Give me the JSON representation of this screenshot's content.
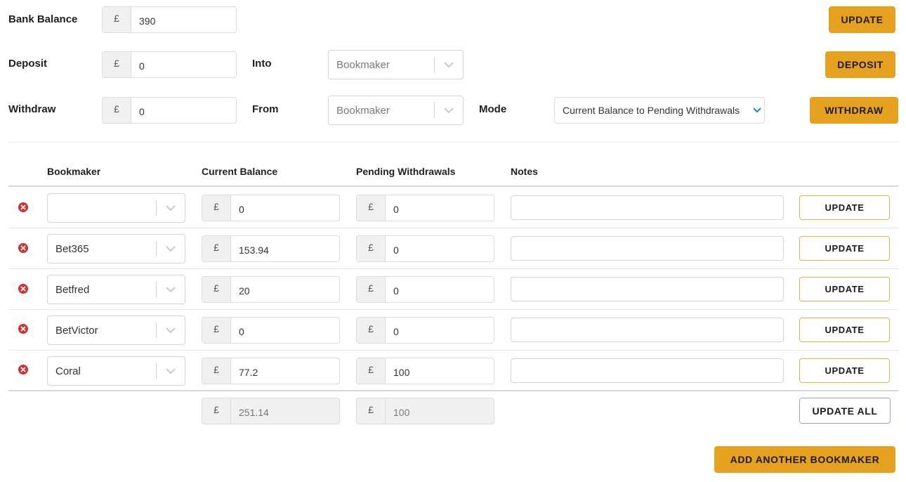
{
  "controls": {
    "bank_balance_label": "Bank Balance",
    "bank_balance_value": "390",
    "currency": "£",
    "update_button": "UPDATE",
    "deposit_label": "Deposit",
    "deposit_value": "0",
    "into_label": "Into",
    "into_placeholder": "Bookmaker",
    "deposit_button": "DEPOSIT",
    "withdraw_label": "Withdraw",
    "withdraw_value": "0",
    "from_label": "From",
    "from_placeholder": "Bookmaker",
    "mode_label": "Mode",
    "mode_value": "Current Balance to Pending Withdrawals",
    "withdraw_button": "WITHDRAW"
  },
  "table": {
    "headers": [
      "Bookmaker",
      "Current Balance",
      "Pending Withdrawals",
      "Notes"
    ],
    "rows": [
      {
        "bookmaker": "",
        "current_balance": "0",
        "pending": "0",
        "notes": "",
        "button": "UPDATE"
      },
      {
        "bookmaker": "Bet365",
        "current_balance": "153.94",
        "pending": "0",
        "notes": "",
        "button": "UPDATE"
      },
      {
        "bookmaker": "Betfred",
        "current_balance": "20",
        "pending": "0",
        "notes": "",
        "button": "UPDATE"
      },
      {
        "bookmaker": "BetVictor",
        "current_balance": "0",
        "pending": "0",
        "notes": "",
        "button": "UPDATE"
      },
      {
        "bookmaker": "Coral",
        "current_balance": "77.2",
        "pending": "100",
        "notes": "",
        "button": "UPDATE"
      }
    ],
    "totals": {
      "current_balance": "251.14",
      "pending": "100"
    },
    "update_all_button": "UPDATE ALL"
  },
  "add_bookmaker_button": "ADD ANOTHER BOOKMAKER",
  "icons": {
    "delete": "remove-circle-icon",
    "chevron": "chevron-down-icon"
  },
  "colors": {
    "accent": "#e6a21f",
    "delete": "#d33030",
    "mode_chevron": "#1a9aa0"
  }
}
